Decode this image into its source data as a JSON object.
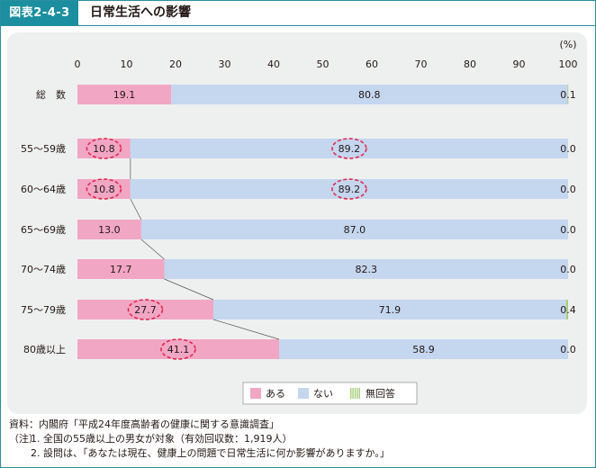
{
  "figure": {
    "label": "図表2-4-3",
    "title": "日常生活への影響"
  },
  "colors": {
    "accent": "#1b8fa0",
    "aru": "#f1a6c4",
    "nai": "#c5d6ef",
    "mukaito": "#a7cf7c",
    "highlight": "#e0284e",
    "panel": "#eef0ef"
  },
  "chart_data": {
    "type": "bar",
    "orientation": "horizontal-stacked",
    "unit": "(%)",
    "xlim": [
      0,
      100
    ],
    "xticks": [
      0,
      10,
      20,
      30,
      40,
      50,
      60,
      70,
      80,
      90,
      100
    ],
    "categories": [
      "総　数",
      "55～59歳",
      "60～64歳",
      "65～69歳",
      "70～74歳",
      "75～79歳",
      "80歳以上"
    ],
    "series": [
      {
        "name": "ある",
        "values": [
          19.1,
          10.8,
          10.8,
          13.0,
          17.7,
          27.7,
          41.1
        ],
        "labels": [
          "19.1",
          "10.8",
          "10.8",
          "13.0",
          "17.7",
          "27.7",
          "41.1"
        ],
        "color": "#f1a6c4"
      },
      {
        "name": "ない",
        "values": [
          80.8,
          89.2,
          89.2,
          87.0,
          82.3,
          71.9,
          58.9
        ],
        "labels": [
          "80.8",
          "89.2",
          "89.2",
          "87.0",
          "82.3",
          "71.9",
          "58.9"
        ],
        "color": "#c5d6ef"
      },
      {
        "name": "無回答",
        "values": [
          0.1,
          0.0,
          0.0,
          0.0,
          0.0,
          0.4,
          0.0
        ],
        "labels": [
          "0.1",
          "0.0",
          "0.0",
          "0.0",
          "0.0",
          "0.4",
          "0.0"
        ],
        "color": "#a7cf7c"
      }
    ],
    "highlighted": [
      {
        "category": "55～59歳",
        "series": "ある"
      },
      {
        "category": "55～59歳",
        "series": "ない"
      },
      {
        "category": "60～64歳",
        "series": "ある"
      },
      {
        "category": "60～64歳",
        "series": "ない"
      },
      {
        "category": "75～79歳",
        "series": "ある"
      },
      {
        "category": "80歳以上",
        "series": "ある"
      }
    ],
    "connector_lines": true,
    "legend_position": "bottom-center",
    "grid": false
  },
  "notes": {
    "source": "資料：内閣府「平成24年度高齢者の健康に関する意識調査」",
    "note_label": "（注）",
    "note1": "1.  全国の55歳以上の男女が対象（有効回収数：1,919人）",
    "note2": "2.  設問は、「あなたは現在、健康上の問題で日常生活に何か影響がありますか。」"
  }
}
